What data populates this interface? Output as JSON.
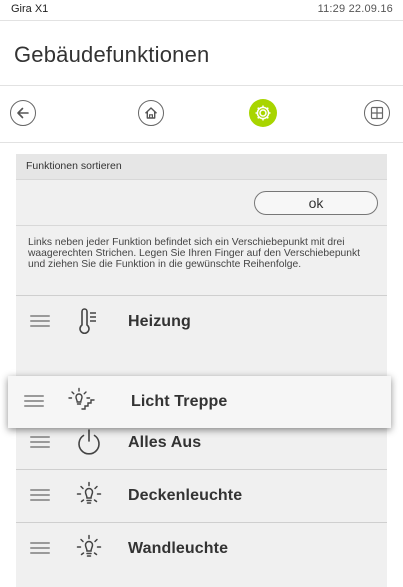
{
  "status": {
    "app_name": "Gira X1",
    "time_date": "11:29  22.09.16"
  },
  "page": {
    "title": "Gebäudefunktionen"
  },
  "nav": [
    {
      "name": "back",
      "icon": "arrow-left-icon"
    },
    {
      "name": "home",
      "icon": "house-icon"
    },
    {
      "name": "settings",
      "icon": "gear-icon",
      "active": true
    },
    {
      "name": "grid",
      "icon": "grid-icon"
    }
  ],
  "panel": {
    "header": "Funktionen sortieren",
    "ok_label": "ok",
    "info_text": "Links neben jeder Funktion befindet sich ein Verschiebepunkt mit drei waagerechten Strichen. Legen Sie Ihren Finger auf den Verschiebepunkt und ziehen Sie die Funktion in die gewünschte Reihenfolge."
  },
  "functions": [
    {
      "label": "Heizung",
      "icon": "thermometer-icon"
    },
    {
      "label": "Licht Treppe",
      "icon": "stair-light-icon",
      "dragging": true
    },
    {
      "label": "Alles Aus",
      "icon": "power-icon"
    },
    {
      "label": "Deckenleuchte",
      "icon": "bulb-icon"
    },
    {
      "label": "Wandleuchte",
      "icon": "bulb-icon"
    }
  ],
  "colors": {
    "accent": "#a8d500",
    "background": "#f0f0f0"
  }
}
